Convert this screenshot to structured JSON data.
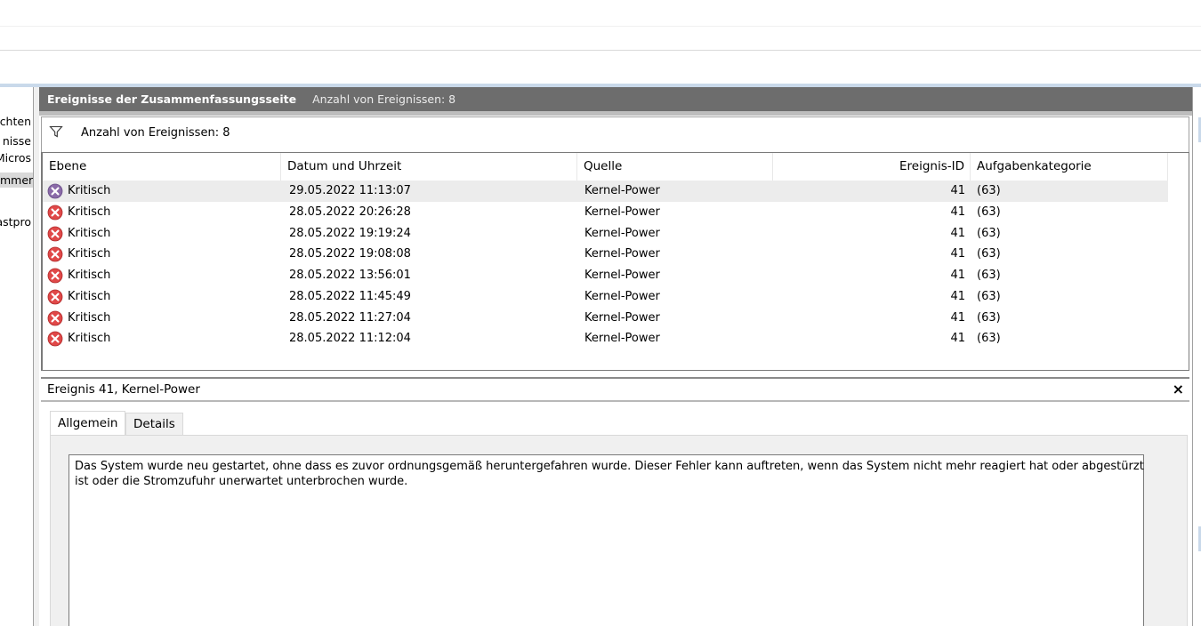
{
  "tree": {
    "items": [
      "chten",
      "nisse",
      "Micros",
      "mmer",
      "astpro"
    ]
  },
  "main": {
    "header_title": "Ereignisse der Zusammenfassungsseite",
    "header_count": "Anzahl von Ereignissen: 8",
    "filter_text": "Anzahl von Ereignissen: 8",
    "icons": {
      "filter": "funnel-icon",
      "error": "error-x-circle-icon"
    },
    "colors": {
      "header_bg": "#6d6d6d",
      "error_red": "#e04848",
      "selected_row": "#ececec"
    }
  },
  "grid": {
    "columns": [
      "Ebene",
      "Datum und Uhrzeit",
      "Quelle",
      "Ereignis-ID",
      "Aufgabenkategorie"
    ],
    "rows": [
      {
        "level": "Kritisch",
        "datetime": "29.05.2022 11:13:07",
        "source": "Kernel-Power",
        "id": "41",
        "category": "(63)"
      },
      {
        "level": "Kritisch",
        "datetime": "28.05.2022 20:26:28",
        "source": "Kernel-Power",
        "id": "41",
        "category": "(63)"
      },
      {
        "level": "Kritisch",
        "datetime": "28.05.2022 19:19:24",
        "source": "Kernel-Power",
        "id": "41",
        "category": "(63)"
      },
      {
        "level": "Kritisch",
        "datetime": "28.05.2022 19:08:08",
        "source": "Kernel-Power",
        "id": "41",
        "category": "(63)"
      },
      {
        "level": "Kritisch",
        "datetime": "28.05.2022 13:56:01",
        "source": "Kernel-Power",
        "id": "41",
        "category": "(63)"
      },
      {
        "level": "Kritisch",
        "datetime": "28.05.2022 11:45:49",
        "source": "Kernel-Power",
        "id": "41",
        "category": "(63)"
      },
      {
        "level": "Kritisch",
        "datetime": "28.05.2022 11:27:04",
        "source": "Kernel-Power",
        "id": "41",
        "category": "(63)"
      },
      {
        "level": "Kritisch",
        "datetime": "28.05.2022 11:12:04",
        "source": "Kernel-Power",
        "id": "41",
        "category": "(63)"
      }
    ]
  },
  "detail": {
    "title": "Ereignis 41, Kernel-Power",
    "close": "×",
    "tabs": [
      "Allgemein",
      "Details"
    ],
    "description_lines": [
      "Das System wurde neu gestartet, ohne dass es zuvor ordnungsgemäß heruntergefahren wurde. Dieser Fehler kann auftreten, wenn das System nicht mehr reagiert hat oder abgestürzt",
      "ist oder die Stromzufuhr unerwartet unterbrochen wurde."
    ]
  }
}
